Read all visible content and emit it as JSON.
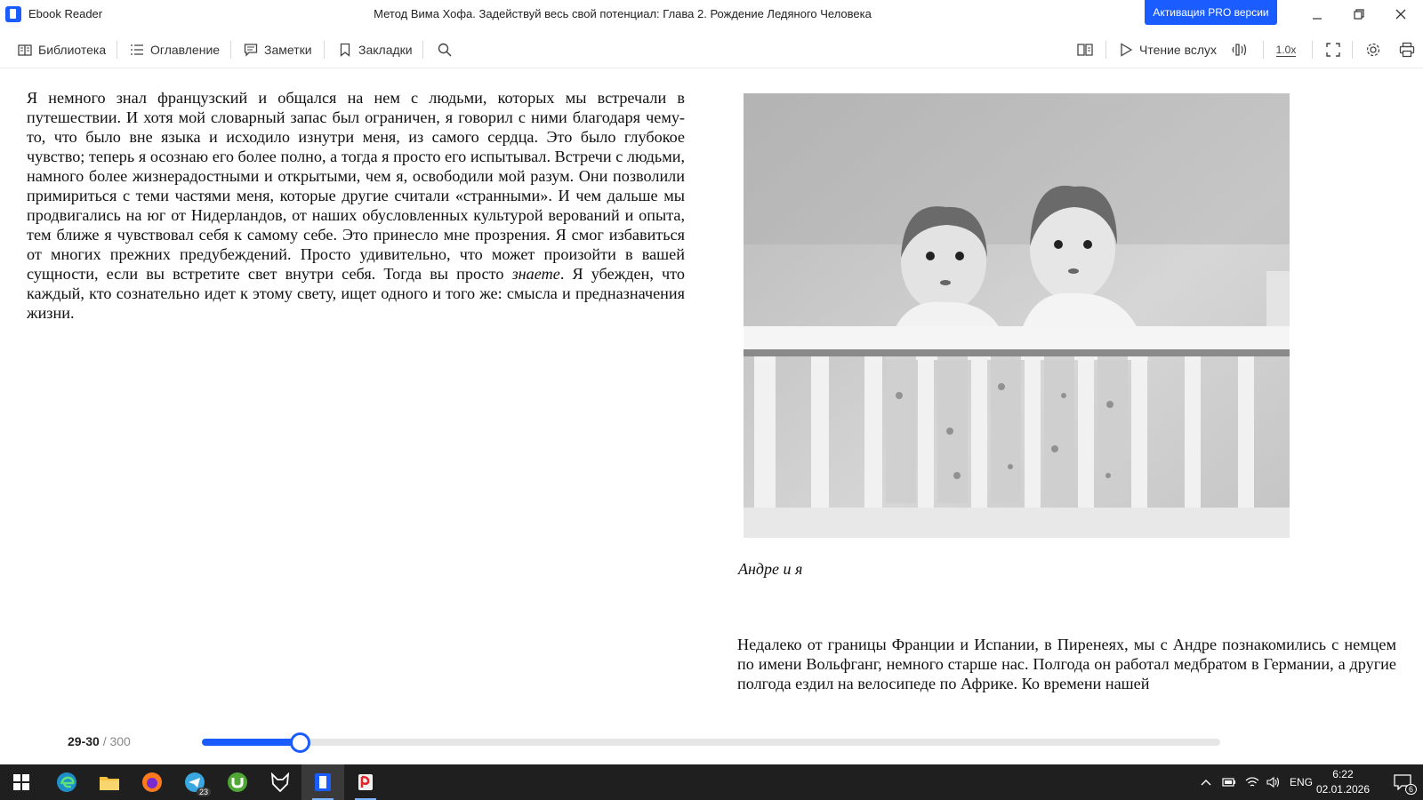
{
  "window": {
    "app_name": "Ebook Reader",
    "doc_title": "Метод Вима Хофа. Задействуй весь свой потенциал: Глава 2. Рождение Ледяного Человека",
    "pro_button": "Активация PRO версии"
  },
  "toolbar": {
    "library": "Библиотека",
    "contents": "Оглавление",
    "notes": "Заметки",
    "bookmarks": "Закладки",
    "read_aloud": "Чтение вслух",
    "speed": "1.0x"
  },
  "content": {
    "left_paragraph_a": "Я немного знал французский и общался на нем с людьми, которых мы встречали в путешествии. И хотя мой словарный запас был ограничен, я говорил с ними благодаря чему-то, что было вне языка и исходило изнутри меня, из самого сердца. Это было глубокое чувство; теперь я осознаю его более полно, а тогда я просто его испытывал. Встречи с людьми, намного более жизнерадостными и открытыми, чем я, освободили мой разум. Они позволили примириться с теми частями меня, которые другие считали «странными». И чем дальше мы продвигались на юг от Нидерландов, от наших обусловленных культурой верований и опыта, тем ближе я чувствовал себя к самому себе. Это принесло мне прозрения. Я смог избавиться от многих прежних предубеждений. Просто удивительно, что может произойти в вашей сущности, если вы встретите свет внутри себя. Тогда вы просто ",
    "left_paragraph_em": "знаете",
    "left_paragraph_b": ". Я убежден, что каждый, кто сознательно идет к этому свету, ищет одного и того же: смысла и предназначения жизни.",
    "caption": "Андре и я",
    "right_paragraph": "Недалеко от границы Франции и Испании, в Пиренеях, мы с Андре познакомились с немцем по имени Вольфганг, немного старше нас. Полгода он работал медбратом в Германии, а другие полгода ездил на велосипеде по Африке. Ко времени нашей"
  },
  "progress": {
    "current": "29-30",
    "separator": "/",
    "total": "300",
    "fraction": 0.095
  },
  "taskbar": {
    "telegram_badge": "23",
    "lang": "ENG",
    "time": "6:22",
    "date": "02.01.2026",
    "notif_count": "6"
  },
  "colors": {
    "accent": "#1a5cff",
    "taskbar": "#1f1f1f"
  }
}
